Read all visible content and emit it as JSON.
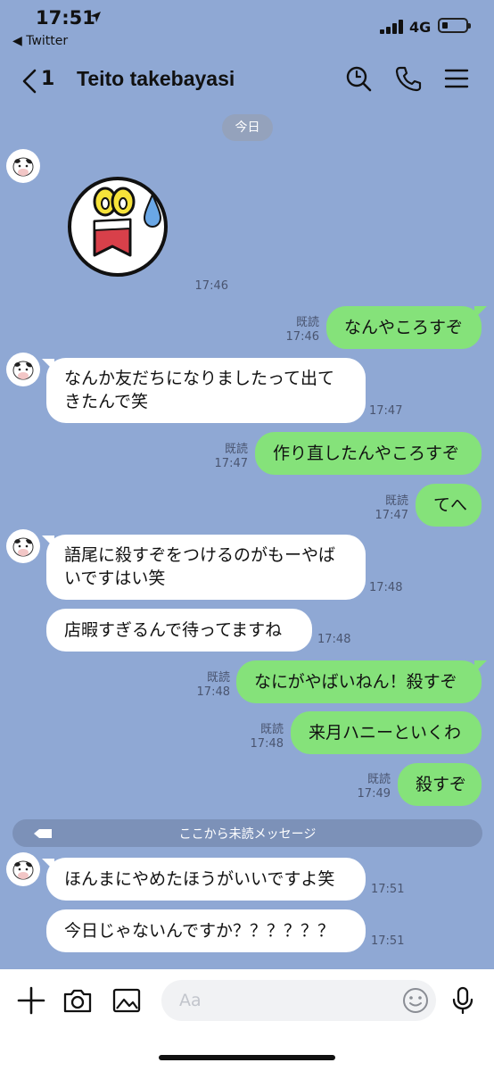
{
  "status_bar": {
    "time": "17:51",
    "back_app": "◀ Twitter",
    "network": "4G"
  },
  "header": {
    "back_count": "1",
    "title": "Teito takebayasi"
  },
  "date_separator": "今日",
  "messages": [
    {
      "type": "sticker",
      "time": "17:46"
    },
    {
      "side": "out",
      "text": "なんやころすぞ",
      "read": "既読",
      "time": "17:46"
    },
    {
      "side": "in",
      "line1": "なんか友だちになりましたって出て",
      "line2": "きたんで笑",
      "time": "17:47"
    },
    {
      "side": "out",
      "text": "作り直したんやころすぞ",
      "read": "既読",
      "time": "17:47"
    },
    {
      "side": "out",
      "text": "てへ",
      "read": "既読",
      "time": "17:47"
    },
    {
      "side": "in",
      "line1": "語尾に殺すぞをつけるのがもーやば",
      "line2": "いですはい笑",
      "time": "17:48"
    },
    {
      "side": "in",
      "text": "店暇すぎるんで待ってますね",
      "time": "17:48"
    },
    {
      "side": "out",
      "text": "なにがやばいねん！殺すぞ",
      "read": "既読",
      "time": "17:48"
    },
    {
      "side": "out",
      "text": "来月ハニーといくわ",
      "read": "既読",
      "time": "17:48"
    },
    {
      "side": "out",
      "text": "殺すぞ",
      "read": "既読",
      "time": "17:49"
    },
    {
      "side": "in",
      "text": "ほんまにやめたほうがいいですよ笑",
      "time": "17:51"
    },
    {
      "side": "in",
      "text": "今日じゃないんですか？？？？？？",
      "time": "17:51"
    }
  ],
  "unread_banner": "ここから未読メッセージ",
  "input": {
    "placeholder": "Aa"
  },
  "icons": [
    "search-icon",
    "phone-icon",
    "menu-icon",
    "plus-icon",
    "camera-icon",
    "image-icon",
    "emoji-icon",
    "mic-icon"
  ]
}
